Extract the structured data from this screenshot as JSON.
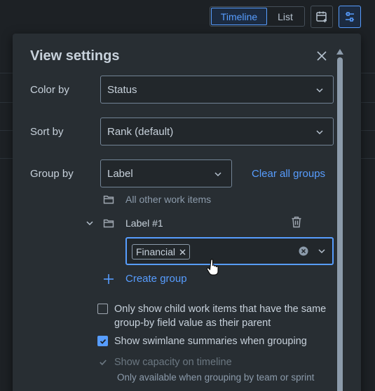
{
  "topbar": {
    "view_tabs": [
      {
        "label": "Timeline",
        "active": true
      },
      {
        "label": "List",
        "active": false
      }
    ],
    "calendar_icon": "calendar-add-icon",
    "settings_icon": "sliders-icon"
  },
  "panel": {
    "title": "View settings",
    "close_icon": "close-icon",
    "color_by": {
      "label": "Color by",
      "value": "Status"
    },
    "sort_by": {
      "label": "Sort by",
      "value": "Rank (default)"
    },
    "group_by": {
      "label": "Group by",
      "value": "Label",
      "clear_label": "Clear all groups"
    },
    "groups": {
      "other_label": "All other work items",
      "group_label": "Label #1",
      "selected_tags": [
        "Financial"
      ],
      "create_label": "Create group"
    },
    "options": [
      {
        "label": "Only show child work items that have the same group-by field value as their parent",
        "checked": false,
        "disabled": false
      },
      {
        "label": "Show swimlane summaries when grouping",
        "checked": true,
        "disabled": false
      },
      {
        "label": "Show capacity on timeline",
        "checked": true,
        "disabled": true
      }
    ],
    "capacity_helper": "Only available when grouping by team or sprint"
  },
  "colors": {
    "accent": "#579dff",
    "background": "#1d2125",
    "panel": "#282e33"
  }
}
